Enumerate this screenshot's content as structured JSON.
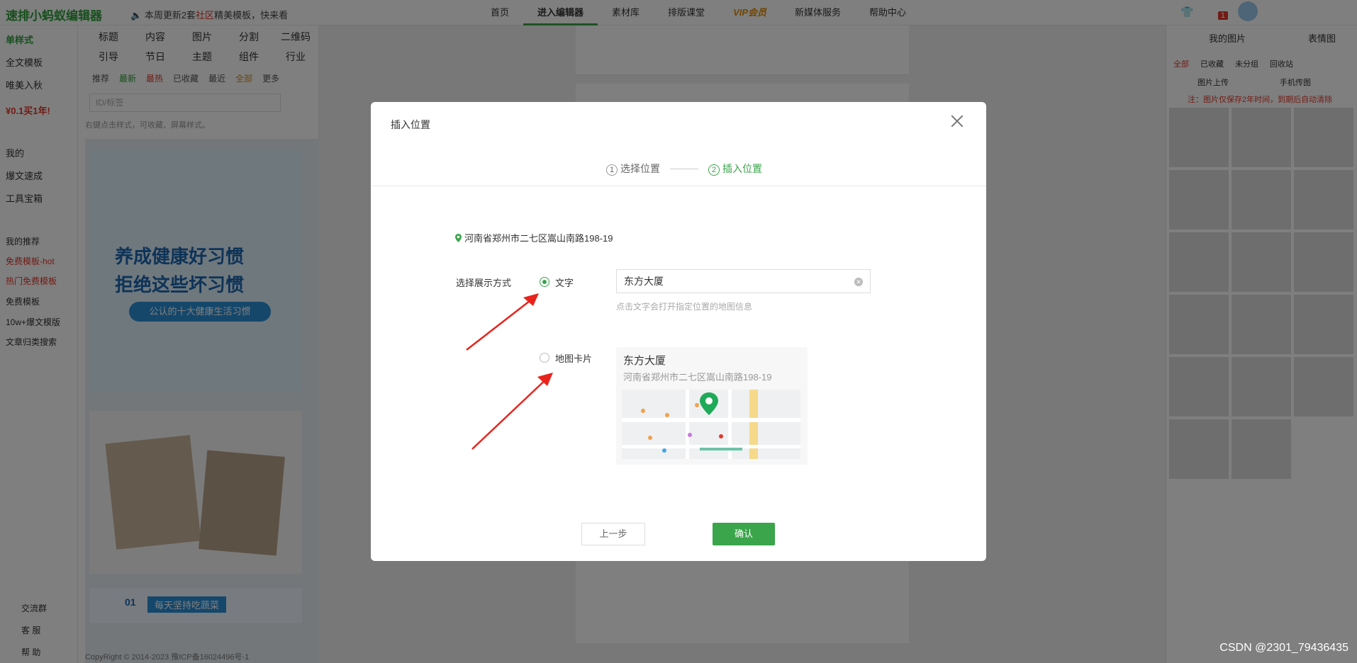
{
  "app": {
    "logo": "速排小蚂蚁编辑器",
    "notice_prefix": "本周更新2套",
    "notice_highlight": "社区",
    "notice_suffix": "精美模板，快来看",
    "badge_count": "1"
  },
  "nav": {
    "items": [
      "首页",
      "进入编辑器",
      "素材库",
      "排版课堂",
      "VIP会员",
      "新媒体服务",
      "帮助中心"
    ]
  },
  "leftnav": {
    "items": [
      {
        "label": "单样式",
        "style": "green"
      },
      {
        "label": "全文模板",
        "style": ""
      },
      {
        "label": "唯美入秋",
        "style": ""
      },
      {
        "label": "¥0.1买1年!",
        "style": "red"
      },
      {
        "label": "我的",
        "style": ""
      },
      {
        "label": "爆文速成",
        "style": ""
      },
      {
        "label": "工具宝箱",
        "style": ""
      },
      {
        "label": "我的推荐",
        "style": "sm"
      },
      {
        "label": "免费模板-hot",
        "style": "redt"
      },
      {
        "label": "热门免费模板",
        "style": "redt"
      },
      {
        "label": "免费模板",
        "style": "sm"
      },
      {
        "label": "10w+爆文模版",
        "style": "sm"
      },
      {
        "label": "文章归类搜索",
        "style": "sm"
      }
    ],
    "bottom": [
      "交流群",
      "客 服",
      "帮 助"
    ]
  },
  "categories": {
    "grid": [
      "标题",
      "内容",
      "图片",
      "分割",
      "二维码",
      "引导",
      "节日",
      "主题",
      "组件",
      "行业"
    ],
    "filters": [
      "推荐",
      "最新",
      "最热",
      "已收藏",
      "最近",
      "全部",
      "更多"
    ],
    "search_placeholder": "ID/标签",
    "tip": "右键点击样式，可收藏、屏幕样式。"
  },
  "template_texts": {
    "t1_line1": "养成健康好习惯",
    "t1_line2": "拒绝这些坏习惯",
    "t1_line3": "公认的十大健康生活习惯",
    "t3_num": "01",
    "t3_text": "每天坚持吃蔬菜"
  },
  "footer": {
    "copyright": "CopyRight © 2014-2023 豫ICP备16024496号-1"
  },
  "right": {
    "tab1": "我的图片",
    "tab2": "表情图",
    "filters": [
      "全部",
      "已收藏",
      "未分组",
      "回收站"
    ],
    "upload": "图片上传",
    "phone": "手机传图",
    "note": "注：图片仅保存2年时间，到期后自动清除"
  },
  "modal": {
    "title": "插入位置",
    "steps": [
      {
        "num": "1",
        "label": "选择位置",
        "active": false
      },
      {
        "num": "2",
        "label": "插入位置",
        "active": true
      }
    ],
    "address": "河南省郑州市二七区嵩山南路198-19",
    "choose_label": "选择展示方式",
    "options": [
      {
        "label": "文字",
        "selected": true
      },
      {
        "label": "地图卡片",
        "selected": false
      }
    ],
    "text_value": "东方大厦",
    "hint": "点击文字会打开指定位置的地图信息",
    "card": {
      "name": "东方大厦",
      "address": "河南省郑州市二七区嵩山南路198-19"
    },
    "prev_button": "上一步",
    "ok_button": "确认"
  },
  "watermark": "CSDN @2301_79436435",
  "colors": {
    "accent": "#3aa54a",
    "danger": "#e0392b",
    "overlay": "rgba(0,0,0,0.5)"
  }
}
